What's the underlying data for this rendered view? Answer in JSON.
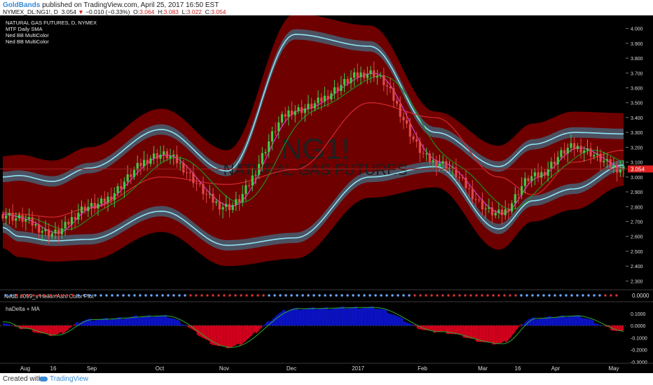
{
  "header": {
    "author": "GoldBands",
    "published": "published on TradingView.com, April 25, 2017 16:50 EST",
    "symbol": "NYMEX_DL:NG1!, D",
    "last": "3.054",
    "change": "−0.010 (−0.33%)",
    "o_label": "O:",
    "o": "3.064",
    "h_label": "H:",
    "h": "3.083",
    "l_label": "L:",
    "l": "3.022",
    "c_label": "C:",
    "c": "3.054",
    "down_arrow": "▼"
  },
  "legend": [
    "NATURAL GAS FUTURES, D, NYMEX",
    "MTF Daily SMA",
    "Ned BB MultiColor",
    "Ned BB MultiColor"
  ],
  "watermark": {
    "symbol": "NG1!",
    "name": "NATURAL GAS FUTURES"
  },
  "colors": {
    "background": "#000000",
    "up": "#3ec94a",
    "down": "#e04848",
    "outer_band": "#6e0000",
    "inner_band": "#4a5566",
    "inner_line": "#8fe3f2",
    "sma": "#d0262a",
    "fast_ma": "#d43bd4",
    "slow_ma": "#1f8c1f",
    "ha_pos": "#0a12c0",
    "ha_neg": "#d0001c",
    "price_tag": "#e02020"
  },
  "price_pane": {
    "y_ticks": [
      "4.000",
      "3.900",
      "3.800",
      "3.700",
      "3.600",
      "3.500",
      "3.400",
      "3.300",
      "3.200",
      "3.100",
      "3.000",
      "2.900",
      "2.800",
      "2.700",
      "2.600",
      "2.500",
      "2.400",
      "2.300"
    ],
    "current_price": "3.054",
    "ylim": [
      2.25,
      4.05
    ]
  },
  "dots_pane": {
    "label": "NedB #099_s Heikin Ashi Color Plot",
    "value": "0.0000"
  },
  "delta_pane": {
    "label": "haDelta + MA",
    "y_ticks": [
      "0.1000",
      "0.0000",
      "-0.1000",
      "-0.2000",
      "-0.3000"
    ],
    "ylim": [
      -0.3,
      0.18
    ]
  },
  "x_axis": {
    "labels": [
      "Aug",
      "16",
      "Sep",
      "Oct",
      "Nov",
      "Dec",
      "2017",
      "Feb",
      "Mar",
      "16",
      "Apr",
      "May"
    ]
  },
  "footer": {
    "created": "Created with",
    "brand": "TradingView"
  },
  "chart_data": {
    "type": "candlestick",
    "title": "NATURAL GAS FUTURES, D, NYMEX",
    "x": [
      "2016-07-25",
      "2016-08-01",
      "2016-08-16",
      "2016-09-01",
      "2016-10-03",
      "2016-11-01",
      "2016-12-01",
      "2017-01-03",
      "2017-02-01",
      "2017-03-01",
      "2017-03-16",
      "2017-04-03",
      "2017-04-25"
    ],
    "close": [
      2.75,
      2.72,
      2.62,
      2.8,
      3.15,
      2.8,
      3.45,
      3.7,
      3.1,
      2.75,
      3.0,
      3.2,
      3.054
    ],
    "upper_band": [
      3.0,
      3.01,
      2.97,
      3.06,
      3.32,
      3.04,
      3.96,
      3.88,
      3.3,
      3.07,
      3.22,
      3.3,
      3.29
    ],
    "lower_band": [
      2.66,
      2.6,
      2.57,
      2.58,
      2.77,
      2.54,
      2.59,
      3.0,
      3.07,
      2.65,
      2.84,
      2.92,
      3.08
    ],
    "sma": [
      2.76,
      2.75,
      2.73,
      2.79,
      3.0,
      2.95,
      3.05,
      3.5,
      3.4,
      3.0,
      2.88,
      3.1,
      3.18
    ],
    "ha_delta": [
      0.03,
      -0.02,
      -0.08,
      0.05,
      0.08,
      -0.18,
      0.14,
      0.15,
      -0.05,
      -0.15,
      0.06,
      0.08,
      -0.05
    ],
    "ylim": [
      2.25,
      4.05
    ]
  }
}
